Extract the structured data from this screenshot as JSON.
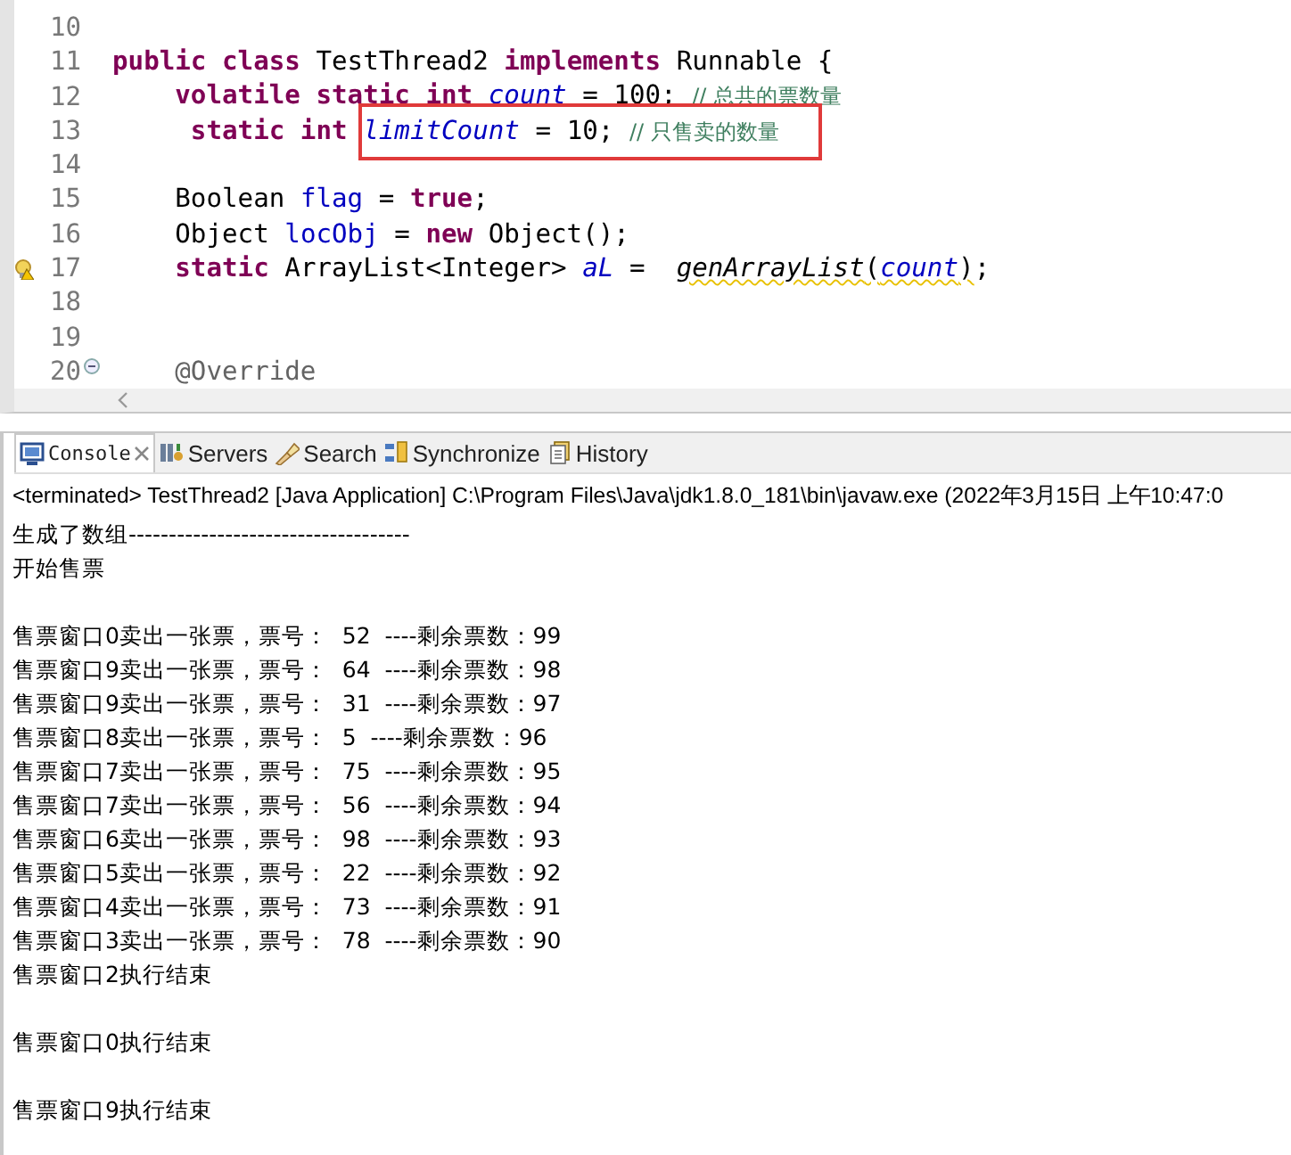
{
  "editor": {
    "lines": [
      {
        "number": "10",
        "kind": "code"
      },
      {
        "number": "11",
        "kind": "code",
        "tokens": [
          {
            "kind": "keyword",
            "text": "public class"
          },
          {
            "kind": "plain",
            "text": " TestThread2 "
          },
          {
            "kind": "keyword",
            "text": "implements"
          },
          {
            "kind": "plain",
            "text": " Runnable {"
          }
        ]
      },
      {
        "number": "12",
        "kind": "code",
        "tokens": [
          {
            "kind": "keyword",
            "text": "    volatile static int "
          },
          {
            "kind": "static-field",
            "text": "count"
          },
          {
            "kind": "plain",
            "text": " = 100; "
          },
          {
            "kind": "comment",
            "text": "// 总共的票数量"
          }
        ]
      },
      {
        "number": "13",
        "kind": "code",
        "tokens": [
          {
            "kind": "keyword",
            "text": "     static int "
          },
          {
            "kind": "static-field",
            "text": "limitCount",
            "boxed": true
          },
          {
            "kind": "plain",
            "text": " = 10; ",
            "boxed": true
          },
          {
            "kind": "comment",
            "text": "// 只售卖的数量",
            "boxed": true
          }
        ]
      },
      {
        "number": "14",
        "kind": "code"
      },
      {
        "number": "15",
        "kind": "code",
        "tokens": [
          {
            "kind": "plain",
            "text": "    Boolean "
          },
          {
            "kind": "field",
            "text": "flag"
          },
          {
            "kind": "plain",
            "text": " = "
          },
          {
            "kind": "keyword",
            "text": "true"
          },
          {
            "kind": "plain",
            "text": ";"
          }
        ]
      },
      {
        "number": "16",
        "kind": "code",
        "tokens": [
          {
            "kind": "plain",
            "text": "    Object "
          },
          {
            "kind": "field",
            "text": "locObj"
          },
          {
            "kind": "plain",
            "text": " = "
          },
          {
            "kind": "keyword",
            "text": "new"
          },
          {
            "kind": "plain",
            "text": " Object();"
          }
        ]
      },
      {
        "number": "17",
        "kind": "warning",
        "tokens": [
          {
            "kind": "keyword",
            "text": "    static"
          },
          {
            "kind": "plain",
            "text": " ArrayList<Integer> "
          },
          {
            "kind": "static-field",
            "text": "aL"
          },
          {
            "kind": "plain",
            "text": " =  "
          },
          {
            "kind": "static-call",
            "text": "genArrayList",
            "warning": true
          },
          {
            "kind": "plain",
            "text": "(",
            "warning": true
          },
          {
            "kind": "static-field",
            "text": "count",
            "warning": true
          },
          {
            "kind": "plain",
            "text": ")",
            "warning": true
          },
          {
            "kind": "plain",
            "text": ";"
          }
        ]
      },
      {
        "number": "18",
        "kind": "code"
      },
      {
        "number": "19",
        "kind": "code"
      },
      {
        "number": "20",
        "kind": "fold",
        "tokens": [
          {
            "kind": "annotation",
            "text": "    @Override"
          }
        ]
      }
    ]
  },
  "console": {
    "tabs": [
      {
        "label": "Console",
        "selected": true,
        "closable": true
      },
      {
        "label": "Servers",
        "selected": false
      },
      {
        "label": "Search",
        "selected": false
      },
      {
        "label": "Synchronize",
        "selected": false
      },
      {
        "label": "History",
        "selected": false
      }
    ],
    "header": "<terminated> TestThread2 [Java Application] C:\\Program Files\\Java\\jdk1.8.0_181\\bin\\javaw.exe (2022年3月15日 上午10:47:0",
    "output": [
      {
        "kind": "text",
        "text": "生成了数组-----------------------------------"
      },
      {
        "kind": "text",
        "text": "开始售票"
      },
      {
        "kind": "blank"
      },
      {
        "kind": "text",
        "text": "售票窗口0卖出一张票，票号：  52  ----剩余票数：99"
      },
      {
        "kind": "text",
        "text": "售票窗口9卖出一张票，票号：  64  ----剩余票数：98"
      },
      {
        "kind": "text",
        "text": "售票窗口9卖出一张票，票号：  31  ----剩余票数：97"
      },
      {
        "kind": "text",
        "text": "售票窗口8卖出一张票，票号：  5  ----剩余票数：96"
      },
      {
        "kind": "text",
        "text": "售票窗口7卖出一张票，票号：  75  ----剩余票数：95"
      },
      {
        "kind": "text",
        "text": "售票窗口7卖出一张票，票号：  56  ----剩余票数：94"
      },
      {
        "kind": "text",
        "text": "售票窗口6卖出一张票，票号：  98  ----剩余票数：93"
      },
      {
        "kind": "text",
        "text": "售票窗口5卖出一张票，票号：  22  ----剩余票数：92"
      },
      {
        "kind": "text",
        "text": "售票窗口4卖出一张票，票号：  73  ----剩余票数：91"
      },
      {
        "kind": "text",
        "text": "售票窗口3卖出一张票，票号：  78  ----剩余票数：90"
      },
      {
        "kind": "text",
        "text": "售票窗口2执行结束"
      },
      {
        "kind": "blank"
      },
      {
        "kind": "text",
        "text": "售票窗口0执行结束"
      },
      {
        "kind": "blank"
      },
      {
        "kind": "text",
        "text": "售票窗口9执行结束"
      }
    ]
  }
}
